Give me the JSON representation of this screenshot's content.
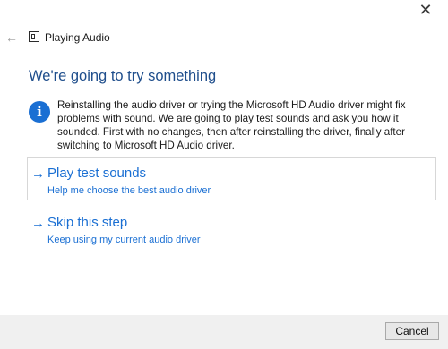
{
  "window": {
    "title": "Playing Audio",
    "close_glyph": "✕",
    "back_glyph": "←"
  },
  "content": {
    "heading": "We're going to try something",
    "info_text": "Reinstalling the audio driver or trying the Microsoft HD Audio driver might fix problems with sound. We are going to play test sounds and ask you how it sounded. First with no changes, then after reinstalling the driver, finally after switching to Microsoft HD Audio driver.",
    "info_glyph": "i",
    "options": [
      {
        "title": "Play test sounds",
        "subtitle": "Help me choose the best audio driver"
      },
      {
        "title": "Skip this step",
        "subtitle": "Keep using my current audio driver"
      }
    ],
    "arrow_glyph": "→"
  },
  "footer": {
    "cancel_label": "Cancel"
  },
  "colors": {
    "accent": "#1a6fd3",
    "heading": "#1f4e8c",
    "footer_bg": "#f0f0f0"
  }
}
